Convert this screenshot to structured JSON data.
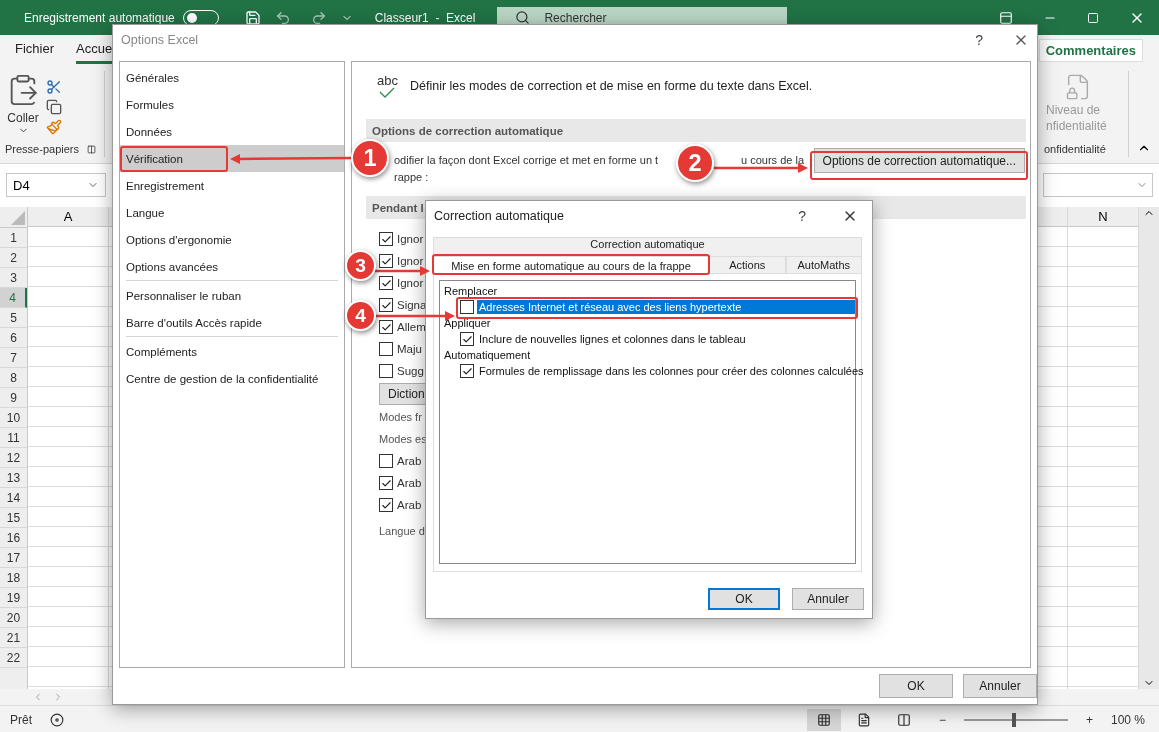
{
  "excel": {
    "title_bar": {
      "autosave_label": "Enregistrement automatique",
      "autosave_on": false,
      "document_title": "Classeur1  -  Excel",
      "search_placeholder": "Rechercher"
    },
    "ribbon_tabs": [
      {
        "label": "Fichier",
        "selected": false
      },
      {
        "label": "Accue",
        "selected": true
      }
    ],
    "comments_button": "Commentaires",
    "clipboard_group": {
      "paste_label": "Coller",
      "group_label": "Presse-papiers"
    },
    "sensitivity_group": {
      "button_line_1": "Niveau de",
      "button_line_2": "nfidentialité",
      "group_label": "onfidentialité"
    },
    "name_box": "D4",
    "columns": [
      {
        "label": "A"
      },
      {
        "label": "N"
      }
    ],
    "rows": [
      {
        "label": "1",
        "selected": false
      },
      {
        "label": "2",
        "selected": false
      },
      {
        "label": "3",
        "selected": false
      },
      {
        "label": "4",
        "selected": true
      },
      {
        "label": "5",
        "selected": false
      },
      {
        "label": "6",
        "selected": false
      },
      {
        "label": "7",
        "selected": false
      },
      {
        "label": "8",
        "selected": false
      },
      {
        "label": "9",
        "selected": false
      },
      {
        "label": "10",
        "selected": false
      },
      {
        "label": "11",
        "selected": false
      },
      {
        "label": "12",
        "selected": false
      },
      {
        "label": "13",
        "selected": false
      },
      {
        "label": "14",
        "selected": false
      },
      {
        "label": "15",
        "selected": false
      },
      {
        "label": "16",
        "selected": false
      },
      {
        "label": "17",
        "selected": false
      },
      {
        "label": "18",
        "selected": false
      },
      {
        "label": "19",
        "selected": false
      },
      {
        "label": "20",
        "selected": false
      },
      {
        "label": "21",
        "selected": false
      },
      {
        "label": "22",
        "selected": false
      }
    ],
    "status_bar": {
      "status": "Prêt",
      "zoom_out": "−",
      "zoom_slider": {
        "level": 0.46
      },
      "zoom_in": "+",
      "zoom": "100 %"
    }
  },
  "options_dialog": {
    "title": "Options Excel",
    "help": "?",
    "sidebar": {
      "groups": [
        {
          "items": [
            {
              "label": "Générales",
              "selected": false
            },
            {
              "label": "Formules",
              "selected": false
            },
            {
              "label": "Données",
              "selected": false
            },
            {
              "label": "Vérification",
              "selected": true
            },
            {
              "label": "Enregistrement",
              "selected": false
            },
            {
              "label": "Langue",
              "selected": false
            },
            {
              "label": "Options d'ergonomie",
              "selected": false
            },
            {
              "label": "Options avancées",
              "selected": false
            }
          ]
        },
        {
          "items": [
            {
              "label": "Personnaliser le ruban",
              "selected": false
            },
            {
              "label": "Barre d'outils Accès rapide",
              "selected": false
            }
          ]
        },
        {
          "items": [
            {
              "label": "Compléments",
              "selected": false
            },
            {
              "label": "Centre de gestion de la confidentialité",
              "selected": false
            }
          ]
        }
      ]
    },
    "header_icon_text": "abc",
    "heading": "Définir les modes de correction et de mise en forme du texte dans Excel.",
    "autocorrect_section": {
      "title": "Options de correction automatique",
      "description_lines": [
        [
          "odifier la façon dont Excel corrige et met en forme un t",
          "u cours de la"
        ],
        [
          "rappe :"
        ]
      ],
      "button": "Options de correction automatique..."
    },
    "spelling_section": {
      "title": "Pendant l",
      "items": [
        {
          "kind": "checkbox",
          "label": "Ignor",
          "checked": true
        },
        {
          "kind": "checkbox",
          "label": "Ignor",
          "checked": true
        },
        {
          "kind": "checkbox",
          "label": "Ignor",
          "checked": true
        },
        {
          "kind": "checkbox",
          "label": "Signa",
          "checked": true
        },
        {
          "kind": "checkbox",
          "label": "Allem",
          "checked": true
        },
        {
          "kind": "checkbox",
          "label": "Maju",
          "checked": false
        },
        {
          "kind": "checkbox",
          "label": "Sugg",
          "checked": false
        },
        {
          "kind": "button",
          "label": "Diction"
        },
        {
          "kind": "text",
          "label": "Modes fr"
        },
        {
          "kind": "text",
          "label": "Modes es"
        },
        {
          "kind": "checkbox",
          "label": "Arab",
          "checked": false
        },
        {
          "kind": "checkbox",
          "label": "Arab",
          "checked": true
        },
        {
          "kind": "checkbox",
          "label": "Arab",
          "checked": true
        },
        {
          "kind": "text",
          "label": "Langue d"
        }
      ]
    },
    "buttons": [
      "OK",
      "Annuler"
    ]
  },
  "autocorrect_dialog": {
    "title": "Correction automatique",
    "help": "?",
    "back_tabs": [
      {
        "label": "Correction automatique",
        "selected": false
      }
    ],
    "tabs": [
      {
        "label": "Mise en forme automatique au cours de la frappe",
        "selected": true
      },
      {
        "label": "Actions",
        "selected": false
      },
      {
        "label": "AutoMaths",
        "selected": false
      }
    ],
    "groups": [
      {
        "title": "Remplacer",
        "options": [
          {
            "label": "Adresses Internet et réseau avec des liens hypertexte",
            "checked": false,
            "selected": true
          }
        ]
      },
      {
        "title": "Appliquer",
        "options": [
          {
            "label": "Inclure de nouvelles lignes et colonnes dans le tableau",
            "checked": true,
            "selected": false
          }
        ]
      },
      {
        "title": "Automatiquement",
        "options": [
          {
            "label": "Formules de remplissage dans les colonnes pour créer des colonnes calculées",
            "checked": true,
            "selected": false
          }
        ]
      }
    ],
    "buttons": [
      {
        "label": "OK",
        "default": true
      },
      {
        "label": "Annuler",
        "default": false
      }
    ]
  },
  "annotations": [
    {
      "number": "1"
    },
    {
      "number": "2"
    },
    {
      "number": "3"
    },
    {
      "number": "4"
    }
  ]
}
